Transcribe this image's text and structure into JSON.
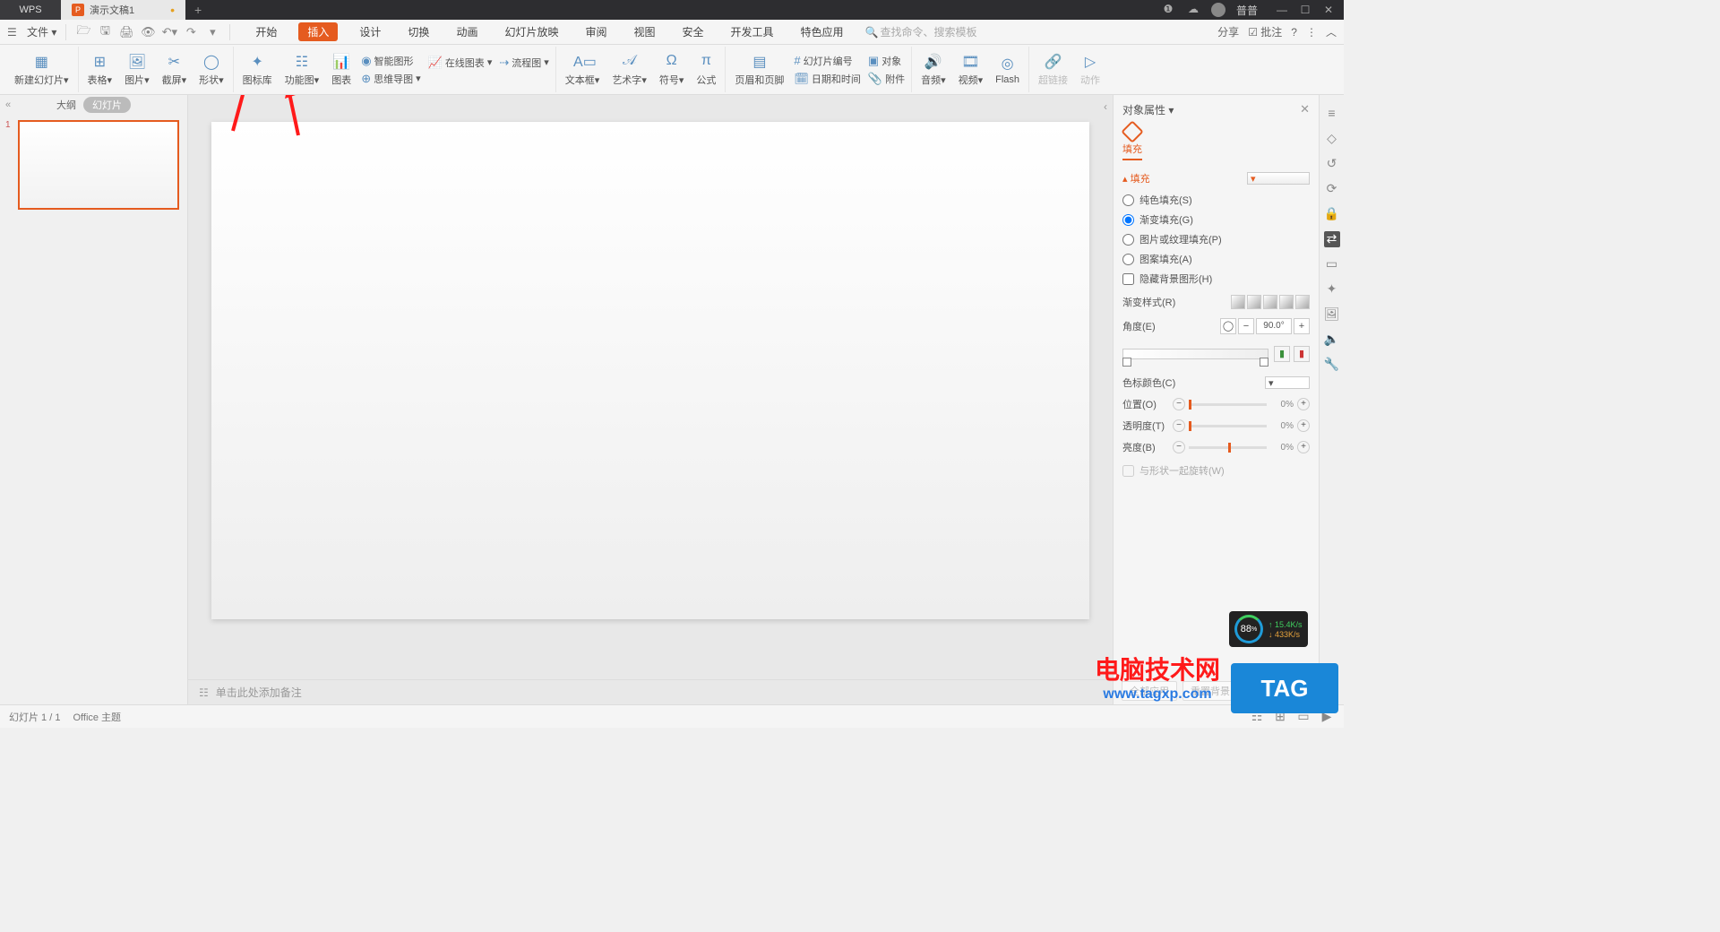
{
  "title_bar": {
    "app": "WPS",
    "doc_tab": "演示文稿1",
    "user": "普普"
  },
  "menu": {
    "file": "文件",
    "tabs": [
      "开始",
      "插入",
      "设计",
      "切换",
      "动画",
      "幻灯片放映",
      "审阅",
      "视图",
      "安全",
      "开发工具",
      "特色应用"
    ],
    "active_tab": "插入",
    "search_placeholder": "查找命令、搜索模板",
    "share": "分享",
    "annotate": "批注"
  },
  "ribbon": {
    "new_slide": "新建幻灯片",
    "table": "表格",
    "picture": "图片",
    "screenshot": "截屏",
    "shape": "形状",
    "icon_lib": "图标库",
    "feature": "功能图",
    "chart": "图表",
    "smart": "智能图形",
    "online_chart": "在线图表",
    "flowchart": "流程图",
    "mindmap": "思维导图",
    "textbox": "文本框",
    "wordart": "艺术字",
    "symbol": "符号",
    "equation": "公式",
    "header_footer": "页眉和页脚",
    "slide_no": "幻灯片编号",
    "datetime": "日期和时间",
    "object": "对象",
    "attachment": "附件",
    "audio": "音频",
    "video": "视频",
    "flash": "Flash",
    "hyperlink": "超链接",
    "action": "动作"
  },
  "side": {
    "outline": "大纲",
    "slides": "幻灯片",
    "slide_num": "1"
  },
  "notes": "单击此处添加备注",
  "taskpane": {
    "title": "对象属性",
    "tab_fill": "填充",
    "sec_fill": "填充",
    "opt_solid": "纯色填充(S)",
    "opt_gradient": "渐变填充(G)",
    "opt_pic": "图片或纹理填充(P)",
    "opt_pattern": "图案填充(A)",
    "chk_hidebg": "隐藏背景图形(H)",
    "grad_style": "渐变样式(R)",
    "angle": "角度(E)",
    "angle_val": "90.0°",
    "stop_color": "色标颜色(C)",
    "position": "位置(O)",
    "position_val": "0%",
    "transparency": "透明度(T)",
    "transparency_val": "0%",
    "brightness": "亮度(B)",
    "brightness_val": "0%",
    "rotate_with": "与形状一起旋转(W)",
    "apply_all": "全部应用",
    "reset_bg": "重置背景"
  },
  "status": {
    "slide_count": "幻灯片 1 / 1",
    "theme": "Office 主题"
  },
  "speed": {
    "pct": "88",
    "up": "15.4K/s",
    "down": "433K/s"
  },
  "wm": {
    "l1": "电脑技术网",
    "l2": "www.tagxp.com",
    "tag": "TAG"
  }
}
